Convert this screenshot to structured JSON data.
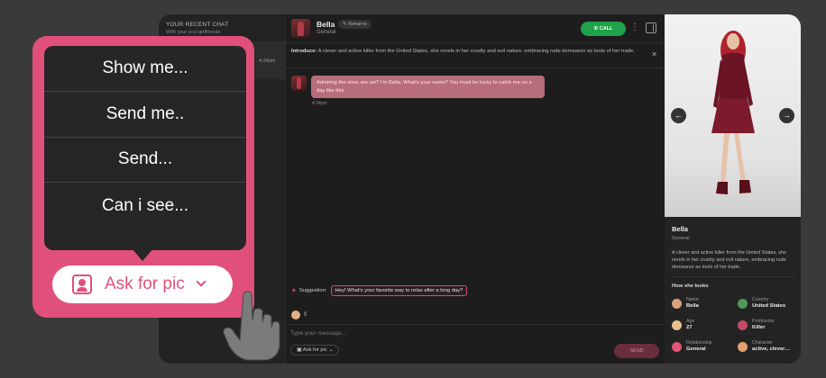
{
  "sidebar": {
    "title": "YOUR RECENT CHAT",
    "subtitle": "With your soul girlfriends",
    "time": "4:24pm"
  },
  "chat": {
    "name": "Bella",
    "subtitle": "General",
    "rename_label": "Rename",
    "call_label": "CALL",
    "intro_label": "Introduce:",
    "intro_text": "A clever and active killer from the United States, she revels in her cruelty and evil nature, embracing rude demeanor as tools of her trade.",
    "message_text": "Admiring the view, are we? I'm Bella. What's your name? You must be lucky to catch me on a day like this.",
    "message_time": "4:34pm",
    "suggestion_label": "Suggestion:",
    "suggestion_text": "Hey! What's your favorite way to relax after a long day?",
    "coins": "0",
    "placeholder": "Type your message...",
    "ask_label_small": "Ask for pic",
    "send_label": "SEND"
  },
  "profile": {
    "name": "Bella",
    "subtitle": "General",
    "description": "A clever and active killer from the United States, she revels in her cruelty and evil nature, embracing rude demeanor as tools of her trade.",
    "looks_title": "How she looks",
    "attributes": [
      {
        "label": "Name",
        "value": "Bella",
        "color": "#d9a27a"
      },
      {
        "label": "Country",
        "value": "United States",
        "color": "#4f9a5a"
      },
      {
        "label": "Age",
        "value": "27",
        "color": "#e7c08d"
      },
      {
        "label": "Profession",
        "value": "Killer",
        "color": "#c44868"
      },
      {
        "label": "Relationship",
        "value": "General",
        "color": "#e05575"
      },
      {
        "label": "Character",
        "value": "active, clever…",
        "color": "#e5a070"
      }
    ]
  },
  "overlay": {
    "menu_items": [
      "Show me...",
      "Send me..",
      "Send...",
      "Can i see..."
    ],
    "ask_button_label": "Ask for pic",
    "accent": "#e0507a"
  }
}
